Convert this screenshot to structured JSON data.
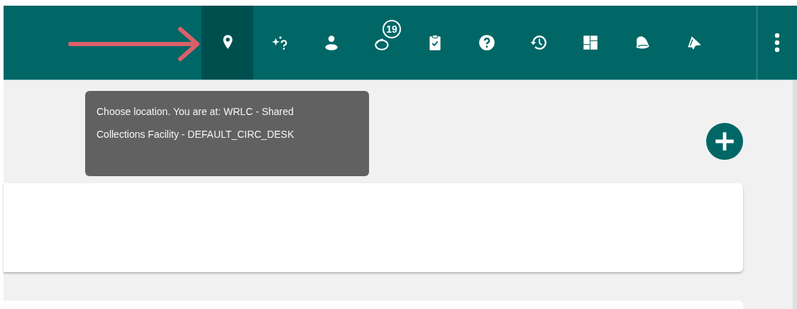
{
  "toolbar": {
    "items": [
      {
        "kind": "location",
        "selected": true
      },
      {
        "kind": "sparkle-help",
        "selected": false
      },
      {
        "kind": "person",
        "selected": false
      },
      {
        "kind": "chat",
        "selected": false,
        "badge": "19"
      },
      {
        "kind": "clipboard",
        "selected": false
      },
      {
        "kind": "help",
        "selected": false
      },
      {
        "kind": "history",
        "selected": false
      },
      {
        "kind": "grid",
        "selected": false
      },
      {
        "kind": "bell",
        "selected": false
      },
      {
        "kind": "megaphone",
        "selected": false
      }
    ]
  },
  "tooltip": {
    "text": "Choose location. You are at: WRLC - Shared Collections Facility - DEFAULT_CIRC_DESK"
  }
}
